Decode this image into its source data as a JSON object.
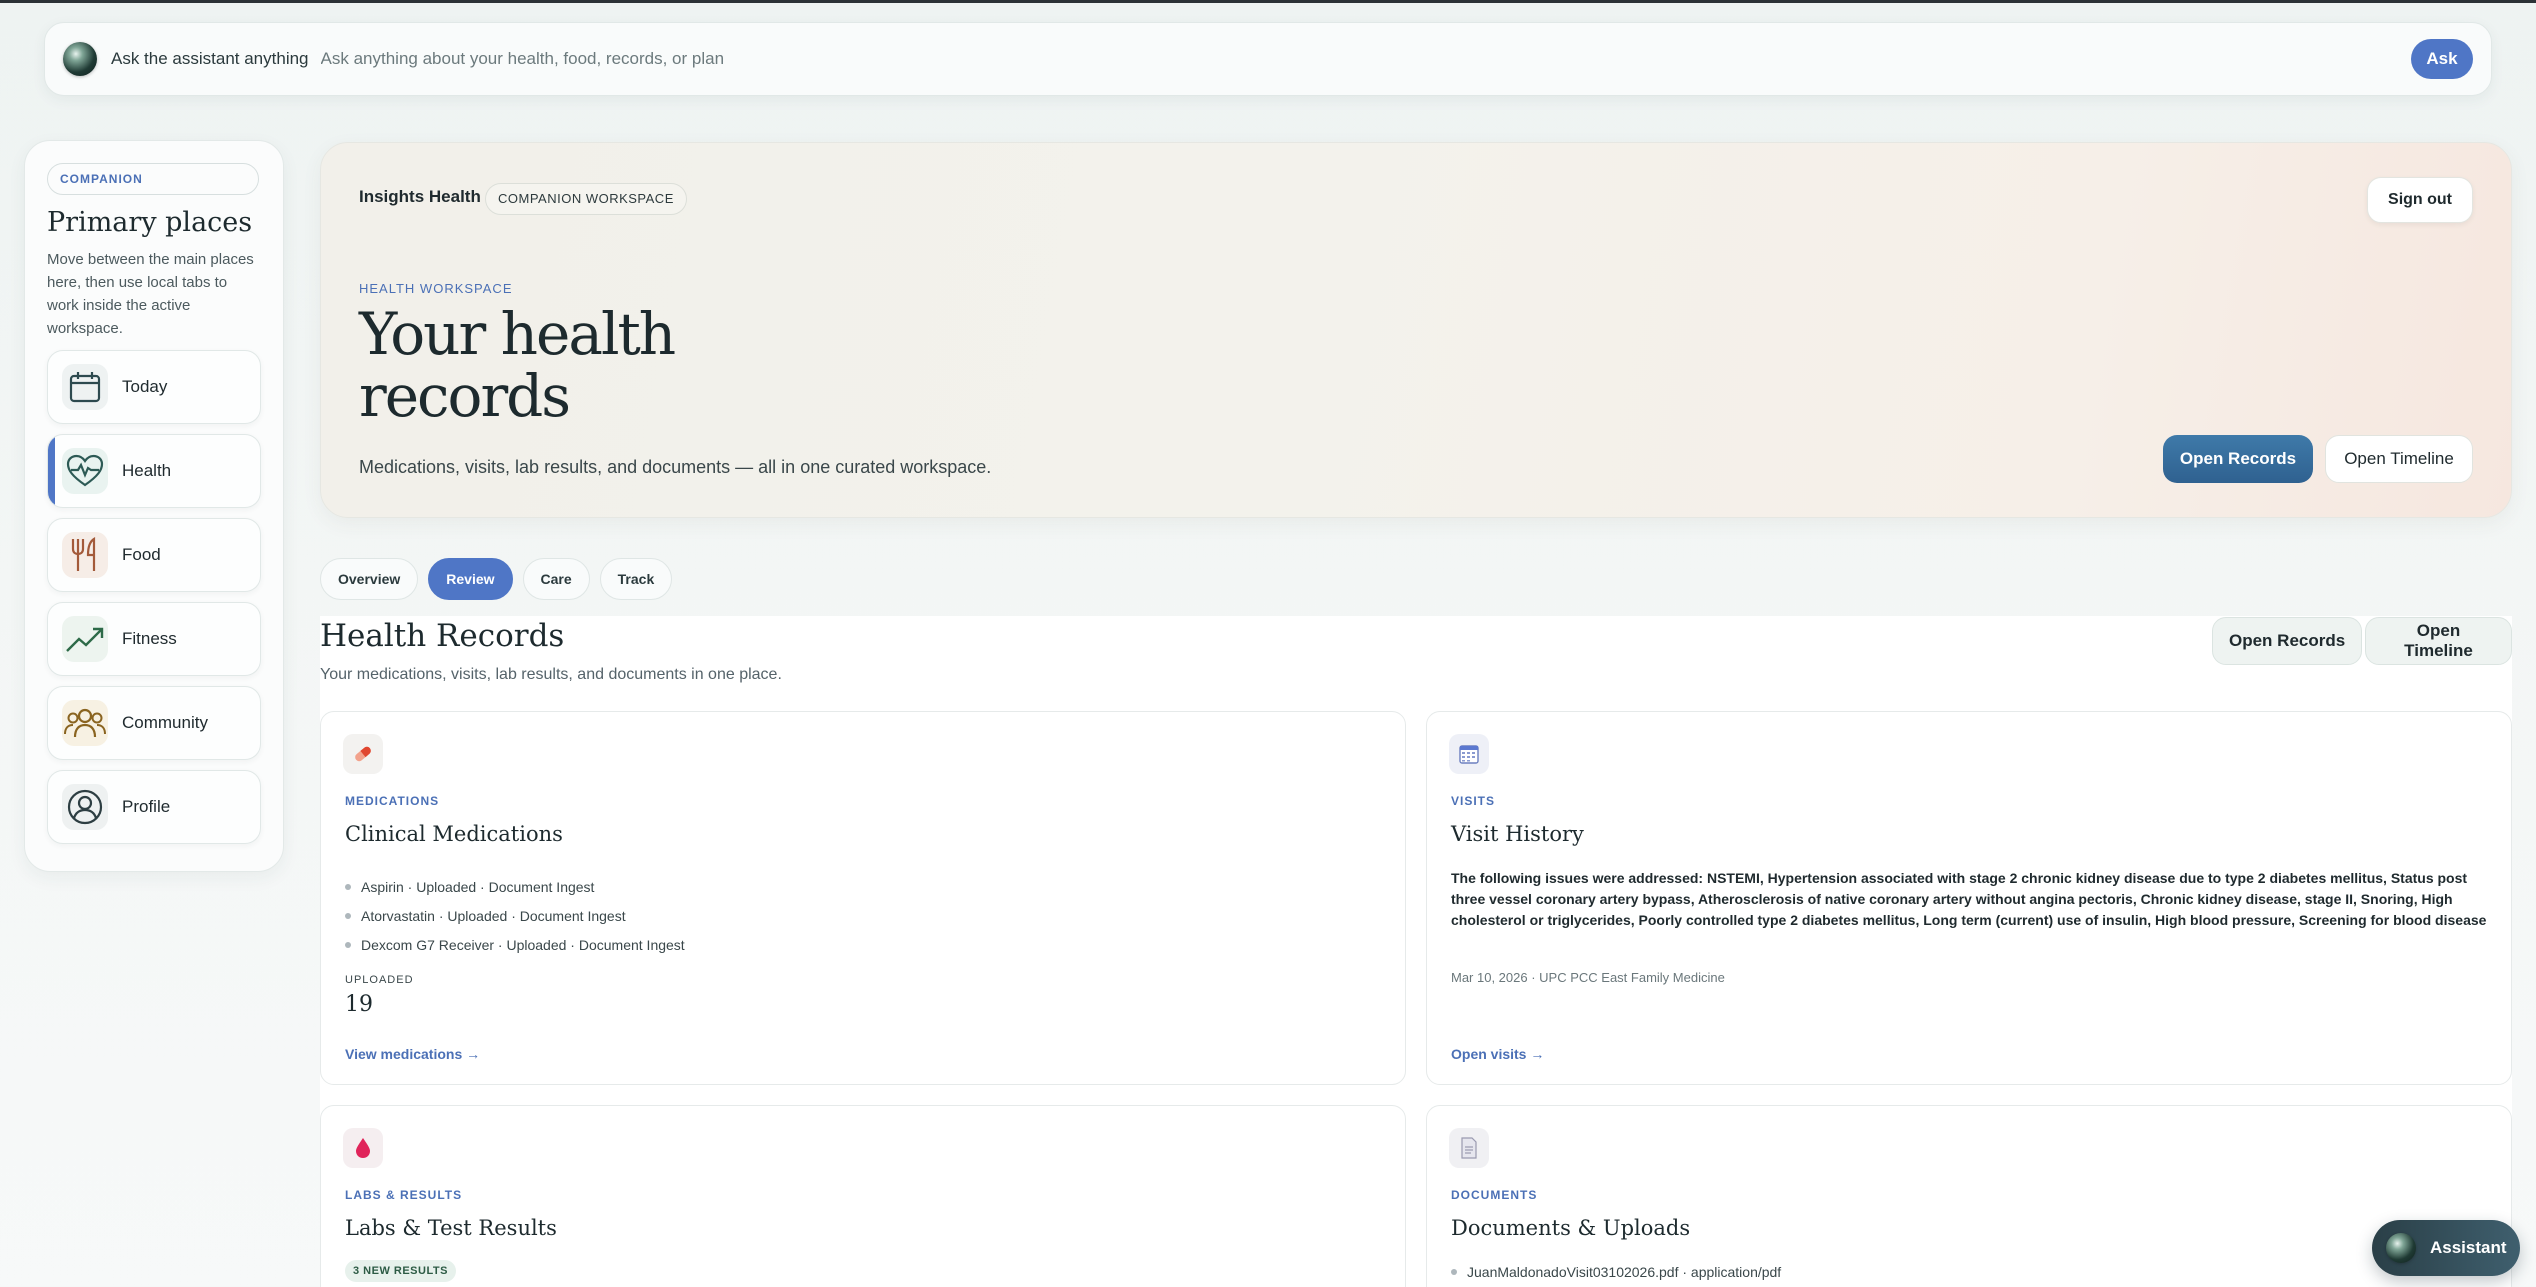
{
  "assistant_bar": {
    "label": "Ask the assistant anything",
    "placeholder": "Ask anything about your health, food, records, or plan",
    "ask_label": "Ask"
  },
  "sidebar": {
    "chip": "COMPANION",
    "title": "Primary places",
    "description": "Move between the main places here, then use local tabs to work inside the active workspace.",
    "items": [
      {
        "label": "Today",
        "icon": "calendar-icon"
      },
      {
        "label": "Health",
        "icon": "heart-pulse-icon",
        "active": true
      },
      {
        "label": "Food",
        "icon": "utensils-icon"
      },
      {
        "label": "Fitness",
        "icon": "trend-up-icon"
      },
      {
        "label": "Community",
        "icon": "people-icon"
      },
      {
        "label": "Profile",
        "icon": "user-circle-icon"
      }
    ]
  },
  "hero": {
    "brand": "Insights Health",
    "brand_chip": "COMPANION WORKSPACE",
    "sign_out": "Sign out",
    "eyebrow": "HEALTH WORKSPACE",
    "title": "Your health records",
    "description": "Medications, visits, lab results, and documents — all in one curated workspace.",
    "primary_button": "Open Records",
    "secondary_button": "Open Timeline"
  },
  "tabs": [
    {
      "label": "Overview"
    },
    {
      "label": "Review",
      "active": true
    },
    {
      "label": "Care"
    },
    {
      "label": "Track"
    }
  ],
  "section": {
    "title": "Health Records",
    "description": "Your medications, visits, lab results, and documents in one place.",
    "open_records": "Open Records",
    "open_timeline": "Open Timeline"
  },
  "cards": {
    "medications": {
      "icon": "pill-icon",
      "kicker": "MEDICATIONS",
      "title": "Clinical Medications",
      "items": [
        "Aspirin · Uploaded · Document Ingest",
        "Atorvastatin · Uploaded · Document Ingest",
        "Dexcom G7 Receiver · Uploaded · Document Ingest"
      ],
      "stat_label": "UPLOADED",
      "stat_value": "19",
      "link": "View medications →"
    },
    "visits": {
      "icon": "calendar-grid-icon",
      "kicker": "VISITS",
      "title": "Visit History",
      "description": "The following issues were addressed: NSTEMI, Hypertension associated with stage 2 chronic kidney disease due to type 2 diabetes mellitus, Status post three vessel coronary artery bypass, Atherosclerosis of native coronary artery without angina pectoris, Chronic kidney disease, stage II, Snoring, High cholesterol or triglycerides, Poorly controlled type 2 diabetes mellitus, Long term (current) use of insulin, High blood pressure, Screening for blood disease",
      "meta": "Mar 10, 2026 · UPC PCC East Family Medicine",
      "link": "Open visits →"
    },
    "labs": {
      "icon": "blood-drop-icon",
      "kicker": "LABS & RESULTS",
      "title": "Labs & Test Results",
      "badge": "3 NEW RESULTS"
    },
    "documents": {
      "icon": "document-icon",
      "kicker": "DOCUMENTS",
      "title": "Documents & Uploads",
      "item": "JuanMaldonadoVisit03102026.pdf · application/pdf"
    }
  },
  "fab": {
    "label": "Assistant"
  },
  "colors": {
    "accent": "#4f76c6",
    "primary_button": "#3a6ea0",
    "kicker": "#4b70b6"
  }
}
